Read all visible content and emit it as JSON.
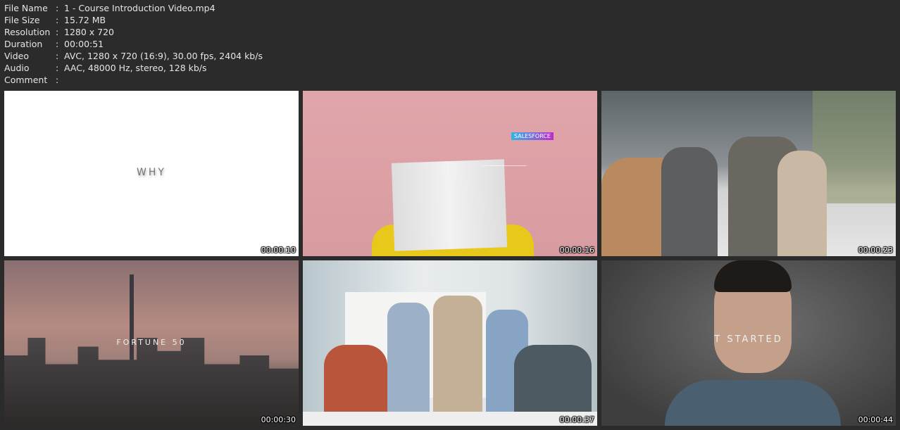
{
  "info": [
    {
      "label": "File Name",
      "value": "1 - Course Introduction Video.mp4"
    },
    {
      "label": "File Size",
      "value": "15.72 MB"
    },
    {
      "label": "Resolution",
      "value": "1280 x 720"
    },
    {
      "label": "Duration",
      "value": "00:00:51"
    },
    {
      "label": "Video",
      "value": "AVC, 1280 x 720 (16:9), 30.00 fps, 2404 kb/s"
    },
    {
      "label": "Audio",
      "value": "AAC, 48000 Hz, stereo, 128 kb/s"
    },
    {
      "label": "Comment",
      "value": ""
    }
  ],
  "separator": ":",
  "thumbnails": [
    {
      "timestamp": "00:00:10",
      "overlay_text": "WHY"
    },
    {
      "timestamp": "00:00:16",
      "overlay_text": "SALESFORCE"
    },
    {
      "timestamp": "00:00:23",
      "overlay_text": ""
    },
    {
      "timestamp": "00:00:30",
      "overlay_text": "FORTUNE 50"
    },
    {
      "timestamp": "00:00:37",
      "overlay_text": ""
    },
    {
      "timestamp": "00:00:44",
      "overlay_text": "T STARTED"
    }
  ]
}
